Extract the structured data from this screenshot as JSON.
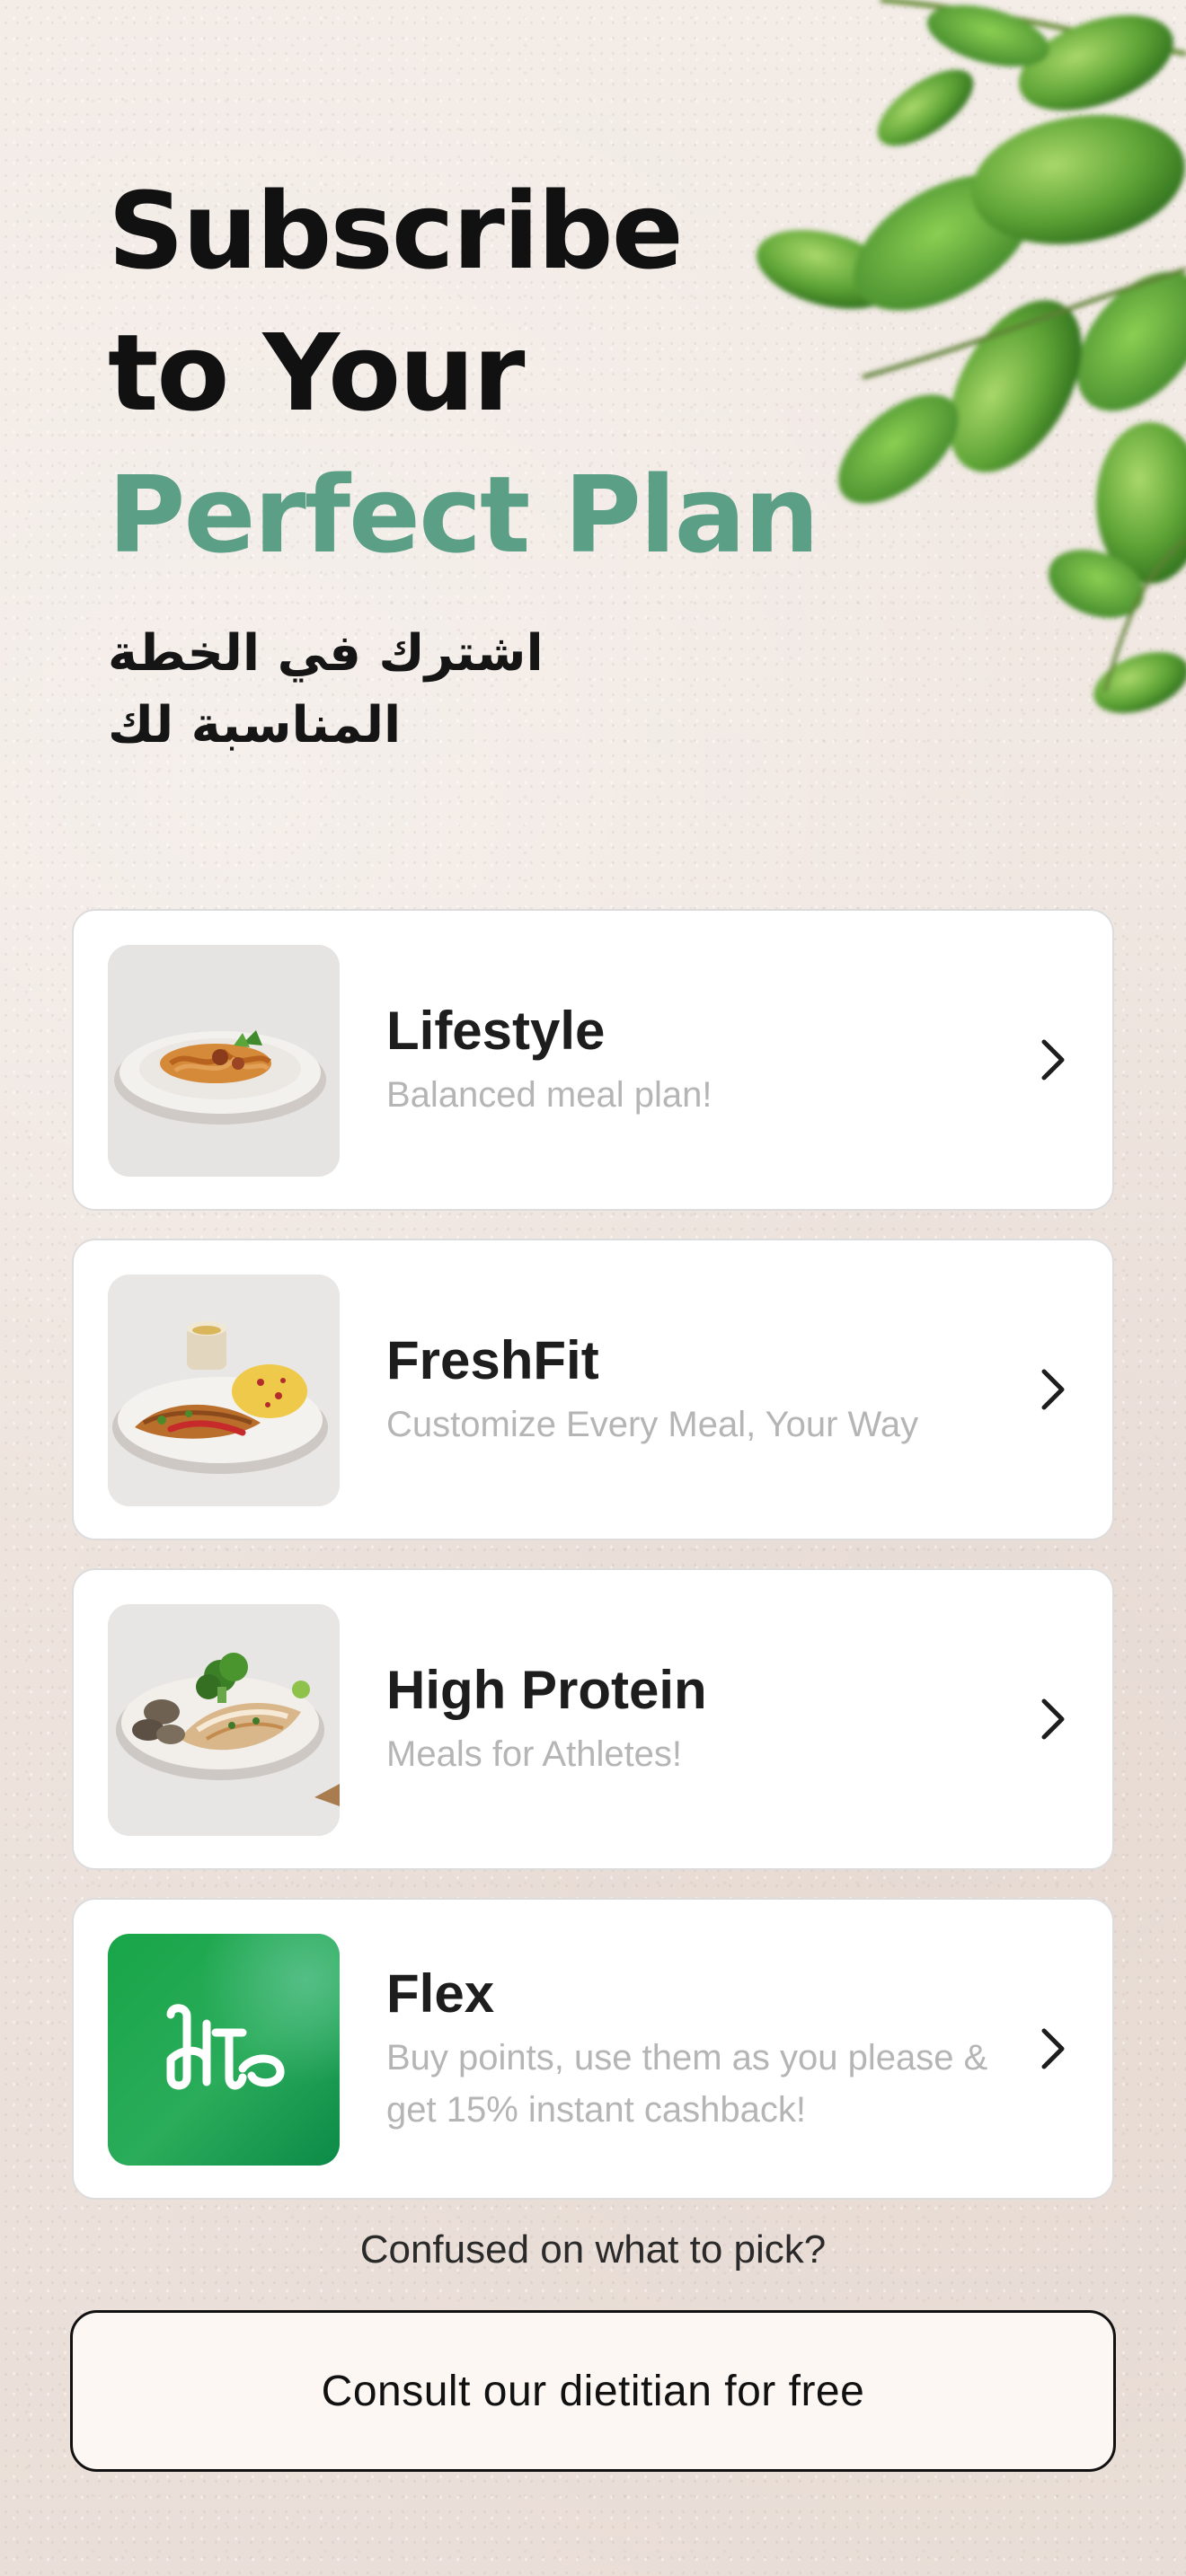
{
  "hero": {
    "title_line1": "Subscribe",
    "title_line2": "to Your",
    "title_line3": "Perfect Plan",
    "subtitle_ar": "اشترك في الخطة المناسبة لك"
  },
  "plans": [
    {
      "name": "Lifestyle",
      "description": "Balanced meal plan!",
      "image": "pasta-dish-image"
    },
    {
      "name": "FreshFit",
      "description": "Customize Every Meal, Your Way",
      "image": "chicken-rice-dish-image"
    },
    {
      "name": "High Protein",
      "description": "Meals for Athletes!",
      "image": "protein-dish-image"
    },
    {
      "name": "Flex",
      "description": "Buy points, use them as you please & get 15% instant cashback!",
      "image": "flex-logo"
    }
  ],
  "help": {
    "question": "Confused on what to pick?",
    "consult_label": "Consult our dietitian for free"
  },
  "colors": {
    "accent_green": "#5a9f86",
    "flex_green": "#1ea34f",
    "background": "#efe5df"
  },
  "icons": {
    "chevron": "chevron-right-icon"
  }
}
